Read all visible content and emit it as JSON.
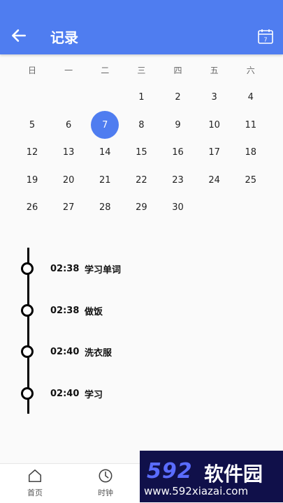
{
  "header": {
    "title": "记录",
    "calendar_badge": "7"
  },
  "calendar": {
    "weekdays": [
      "日",
      "一",
      "二",
      "三",
      "四",
      "五",
      "六"
    ],
    "selected": "7",
    "weeks": [
      [
        "",
        "",
        "",
        "1",
        "2",
        "3",
        "4"
      ],
      [
        "5",
        "6",
        "7",
        "8",
        "9",
        "10",
        "11"
      ],
      [
        "12",
        "13",
        "14",
        "15",
        "16",
        "17",
        "18"
      ],
      [
        "19",
        "20",
        "21",
        "22",
        "23",
        "24",
        "25"
      ],
      [
        "26",
        "27",
        "28",
        "29",
        "30",
        "",
        ""
      ]
    ]
  },
  "timeline": [
    {
      "time": "02:38",
      "label": "学习单词"
    },
    {
      "time": "02:38",
      "label": "做饭"
    },
    {
      "time": "02:40",
      "label": "洗衣服"
    },
    {
      "time": "02:40",
      "label": "学习"
    }
  ],
  "nav": [
    {
      "label": "首页",
      "icon": "home-icon"
    },
    {
      "label": "时钟",
      "icon": "clock-icon"
    }
  ],
  "watermark": {
    "brand": "592",
    "name": "软件园",
    "url": "www.592xiazai.com"
  }
}
